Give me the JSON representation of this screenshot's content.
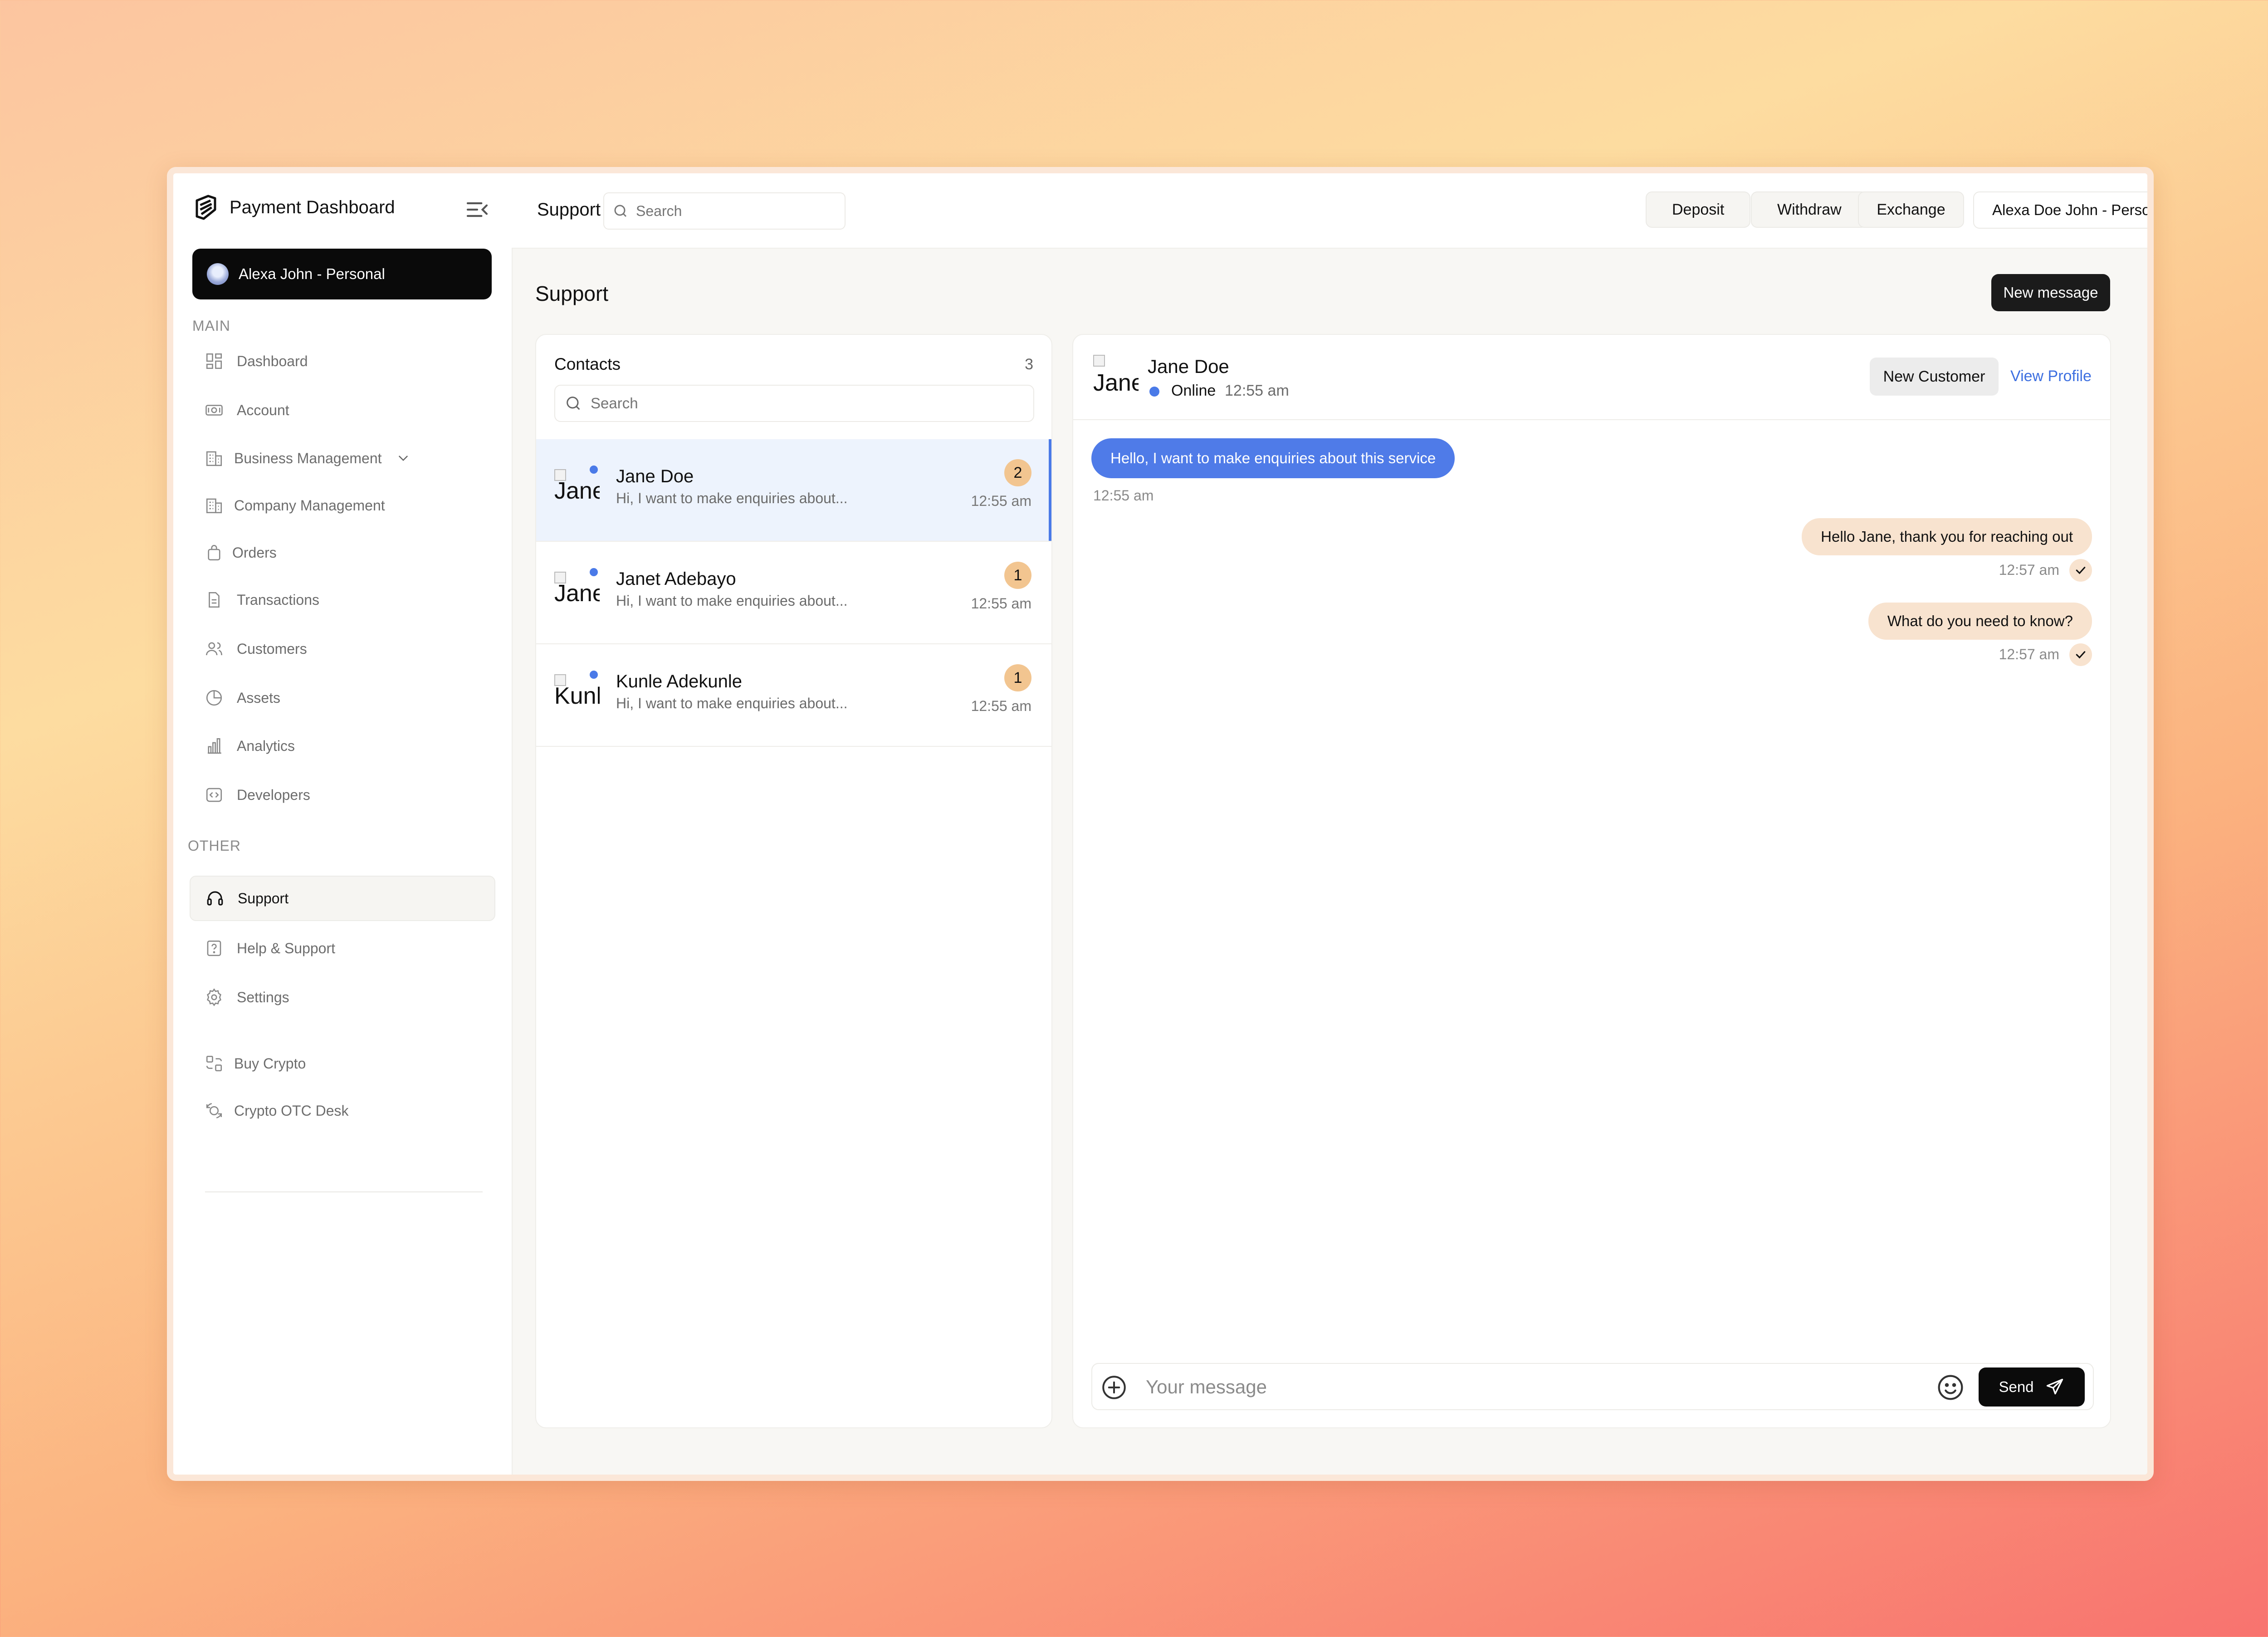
{
  "app": {
    "title": "Payment Dashboard"
  },
  "sidebar": {
    "account": "Alexa John - Personal",
    "section_main": "MAIN",
    "section_other": "OTHER",
    "main_items": [
      {
        "label": "Dashboard",
        "icon": "dashboard-icon"
      },
      {
        "label": "Account",
        "icon": "money-icon"
      },
      {
        "label": "Business Management",
        "icon": "building-icon"
      },
      {
        "label": "Company Management",
        "icon": "building-icon"
      },
      {
        "label": "Orders",
        "icon": "bag-icon"
      },
      {
        "label": "Transactions",
        "icon": "document-icon"
      },
      {
        "label": "Customers",
        "icon": "users-icon"
      },
      {
        "label": "Assets",
        "icon": "pie-icon"
      },
      {
        "label": "Analytics",
        "icon": "bar-chart-icon"
      },
      {
        "label": "Developers",
        "icon": "code-icon"
      }
    ],
    "other_items": [
      {
        "label": "Support",
        "icon": "headset-icon",
        "active": true
      },
      {
        "label": "Help & Support",
        "icon": "help-icon"
      },
      {
        "label": "Settings",
        "icon": "gear-icon"
      }
    ],
    "extra_items": [
      {
        "label": "Buy Crypto",
        "icon": "crypto-icon"
      },
      {
        "label": "Crypto OTC Desk",
        "icon": "otc-icon"
      }
    ]
  },
  "topbar": {
    "title": "Support",
    "search_placeholder": "Search",
    "buttons": [
      "Deposit",
      "Withdraw",
      "Exchange"
    ],
    "account_selector": "Alexa Doe John - Personal"
  },
  "page": {
    "title": "Support",
    "new_message": "New message"
  },
  "contacts": {
    "title": "Contacts",
    "count": "3",
    "search_placeholder": "Search",
    "items": [
      {
        "name": "Jane Doe",
        "avatar_alt": "Jane",
        "preview": "Hi, I want to make enquiries about...",
        "unread": "2",
        "time": "12:55 am"
      },
      {
        "name": "Janet Adebayo",
        "avatar_alt": "Janet",
        "preview": "Hi, I want to make enquiries about...",
        "unread": "1",
        "time": "12:55 am"
      },
      {
        "name": "Kunle Adekunle",
        "avatar_alt": "Kunle",
        "preview": "Hi, I want to make enquiries about...",
        "unread": "1",
        "time": "12:55 am"
      }
    ]
  },
  "chat": {
    "name": "Jane Doe",
    "avatar_alt": "Jane",
    "status": "Online",
    "time": "12:55 am",
    "tag": "New Customer",
    "view_profile": "View Profile",
    "messages": [
      {
        "direction": "in",
        "text": "Hello, I want to make enquiries about this service",
        "time": "12:55 am"
      },
      {
        "direction": "out",
        "text": "Hello Jane, thank you for reaching out",
        "time": "12:57 am"
      },
      {
        "direction": "out",
        "text": "What do you need to know?",
        "time": "12:57 am"
      }
    ],
    "composer_placeholder": "Your message",
    "send_label": "Send"
  },
  "colors": {
    "accent": "#4f7be8",
    "badge": "#f2c590",
    "outgoing_bubble": "#f8e3cf",
    "dark": "#0b0b0b"
  }
}
